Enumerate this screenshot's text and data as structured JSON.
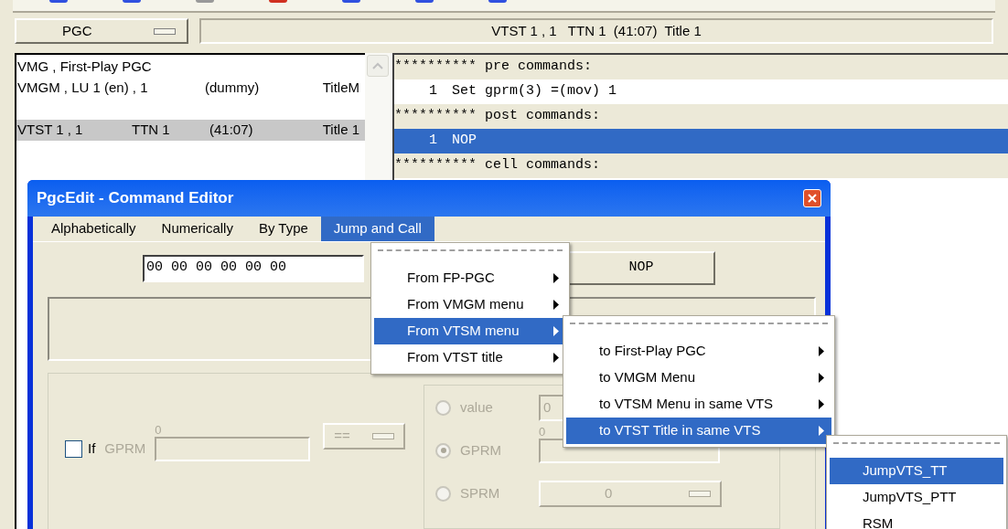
{
  "pgc_selector": {
    "label": "PGC"
  },
  "title_field": {
    "value": "VTST 1 , 1   TTN 1  (41:07)  Title 1"
  },
  "pgc_list": [
    {
      "kind": "entry",
      "cells": [
        "VMG , First-Play PGC"
      ],
      "selected": false
    },
    {
      "kind": "entry",
      "cells": [
        "VMGM , LU 1 (en) , 1",
        "(dummy)",
        "TitleM"
      ],
      "selected": false
    },
    {
      "kind": "spacer"
    },
    {
      "kind": "entry",
      "cells": [
        "VTST 1 , 1",
        "TTN 1",
        "(41:07)",
        "Title 1"
      ],
      "selected": true
    }
  ],
  "commands": [
    {
      "kind": "header",
      "text": "********** pre commands:"
    },
    {
      "kind": "command",
      "number": "1",
      "text": "Set gprm(3) =(mov) 1",
      "selected": false
    },
    {
      "kind": "header",
      "text": "********** post commands:"
    },
    {
      "kind": "command",
      "number": "1",
      "text": "NOP",
      "selected": true
    },
    {
      "kind": "header",
      "text": "********** cell commands:"
    }
  ],
  "dialog": {
    "title": "PgcEdit - Command Editor",
    "menu": [
      {
        "label": "Alphabetically",
        "selected": false
      },
      {
        "label": "Numerically",
        "selected": false
      },
      {
        "label": "By Type",
        "selected": false
      },
      {
        "label": "Jump and Call",
        "selected": true
      }
    ],
    "hex_field": {
      "value": "00 00 00 00 00 00"
    },
    "command_button": {
      "label": "NOP"
    },
    "condition": {
      "checked": false,
      "label": "If",
      "register_label": "GPRM",
      "register_index": "0",
      "operator": "==",
      "disabled": true
    },
    "operand": {
      "disabled": true,
      "options": [
        {
          "kind": "field",
          "label": "value",
          "selected": false,
          "value": "0"
        },
        {
          "kind": "register",
          "label": "GPRM",
          "selected": true,
          "index": "0"
        },
        {
          "kind": "dropdown",
          "label": "SPRM",
          "selected": false,
          "value": "0"
        }
      ]
    }
  },
  "menus": [
    {
      "items": [
        {
          "label": "From FP-PGC",
          "has_submenu": true,
          "selected": false
        },
        {
          "label": "From VMGM menu",
          "has_submenu": true,
          "selected": false
        },
        {
          "label": "From VTSM menu",
          "has_submenu": true,
          "selected": true
        },
        {
          "label": "From VTST title",
          "has_submenu": true,
          "selected": false
        }
      ]
    },
    {
      "items": [
        {
          "label": "to First-Play PGC",
          "has_submenu": true,
          "selected": false
        },
        {
          "label": "to VMGM Menu",
          "has_submenu": true,
          "selected": false
        },
        {
          "label": "to VTSM Menu in same VTS",
          "has_submenu": true,
          "selected": false
        },
        {
          "label": "to VTST Title in same VTS",
          "has_submenu": true,
          "selected": true
        }
      ]
    },
    {
      "items": [
        {
          "label": "JumpVTS_TT",
          "has_submenu": false,
          "selected": true
        },
        {
          "label": "JumpVTS_PTT",
          "has_submenu": false,
          "selected": false
        },
        {
          "label": "RSM",
          "has_submenu": false,
          "selected": false
        }
      ]
    }
  ]
}
